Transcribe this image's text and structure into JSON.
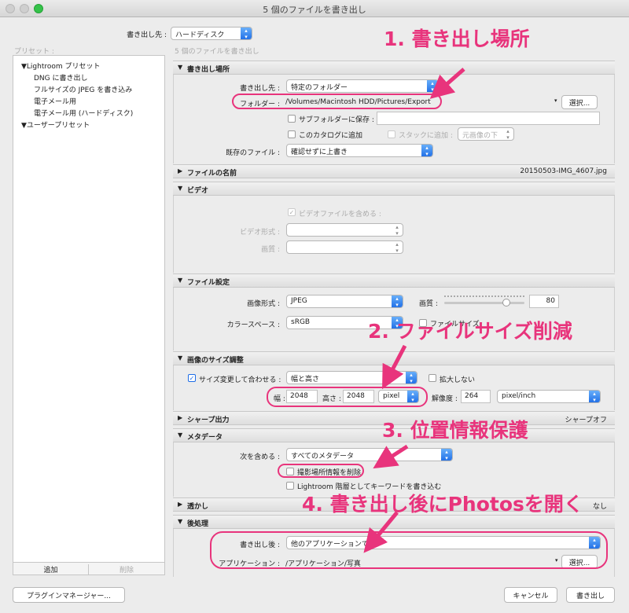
{
  "window": {
    "title": "5 個のファイルを書き出し"
  },
  "header": {
    "export_to_label": "書き出し先 :",
    "export_to_value": "ハードディスク",
    "subtitle": "5 個のファイルを書き出し",
    "presets_label": "プリセット :"
  },
  "presets": {
    "group1": "Lightroom プリセット",
    "items": [
      "DNG に書き出し",
      "フルサイズの JPEG を書き込み",
      "電子メール用",
      "電子メール用 (ハードディスク)"
    ],
    "group2": "ユーザープリセット",
    "add_label": "追加",
    "remove_label": "削除"
  },
  "location": {
    "header": "書き出し場所",
    "export_to_label": "書き出し先 :",
    "export_to_value": "特定のフォルダー",
    "folder_label": "フォルダー :",
    "folder_path": "/Volumes/Macintosh HDD/Pictures/Export",
    "choose_label": "選択...",
    "subfolder_label": "サブフォルダーに保存 :",
    "add_catalog_label": "このカタログに追加",
    "add_stack_label": "スタックに追加 :",
    "stack_value": "元画像の下",
    "existing_label": "既存のファイル :",
    "existing_value": "確認せずに上書き"
  },
  "naming": {
    "header": "ファイルの名前",
    "right": "20150503-IMG_4607.jpg"
  },
  "video": {
    "header": "ビデオ",
    "include_label": "ビデオファイルを含める :",
    "format_label": "ビデオ形式 :",
    "quality_label": "画質 :"
  },
  "file_settings": {
    "header": "ファイル設定",
    "format_label": "画像形式 :",
    "format_value": "JPEG",
    "quality_label": "画質 :",
    "quality_value": "80",
    "quality_fraction": 0.8,
    "colorspace_label": "カラースペース :",
    "colorspace_value": "sRGB",
    "limit_label": "ファイルサイズ"
  },
  "sizing": {
    "header": "画像のサイズ調整",
    "resize_label": "サイズ変更して合わせる :",
    "resize_value": "幅と高さ",
    "no_enlarge_label": "拡大しない",
    "width_label": "幅 :",
    "width_value": "2048",
    "height_label": "高さ :",
    "height_value": "2048",
    "unit_value": "pixel",
    "res_label": "解像度 :",
    "res_value": "264",
    "res_unit": "pixel/inch"
  },
  "sharpen": {
    "header": "シャープ出力",
    "right": "シャープオフ"
  },
  "metadata": {
    "header": "メタデータ",
    "include_label": "次を含める :",
    "include_value": "すべてのメタデータ",
    "remove_location_label": "撮影場所情報を削除",
    "keywords_label": "Lightroom 階層としてキーワードを書き込む"
  },
  "watermark": {
    "header": "透かし",
    "right": "なし"
  },
  "post": {
    "header": "後処理",
    "after_label": "書き出し後 :",
    "after_value": "他のアプリケーションで",
    "app_label": "アプリケーション :",
    "app_path": "/アプリケーション/写真",
    "choose_label": "選択..."
  },
  "footer": {
    "plugin_manager": "プラグインマネージャー...",
    "cancel": "キャンセル",
    "export": "書き出し"
  },
  "annotations": {
    "a1": "1. 書き出し場所",
    "a2": "2. ファイルサイズ削減",
    "a3": "3. 位置情報保護",
    "a4": "4. 書き出し後にPhotosを開く"
  },
  "colors": {
    "accent": "#e8347c",
    "popup_blue": "#1e6de6"
  }
}
